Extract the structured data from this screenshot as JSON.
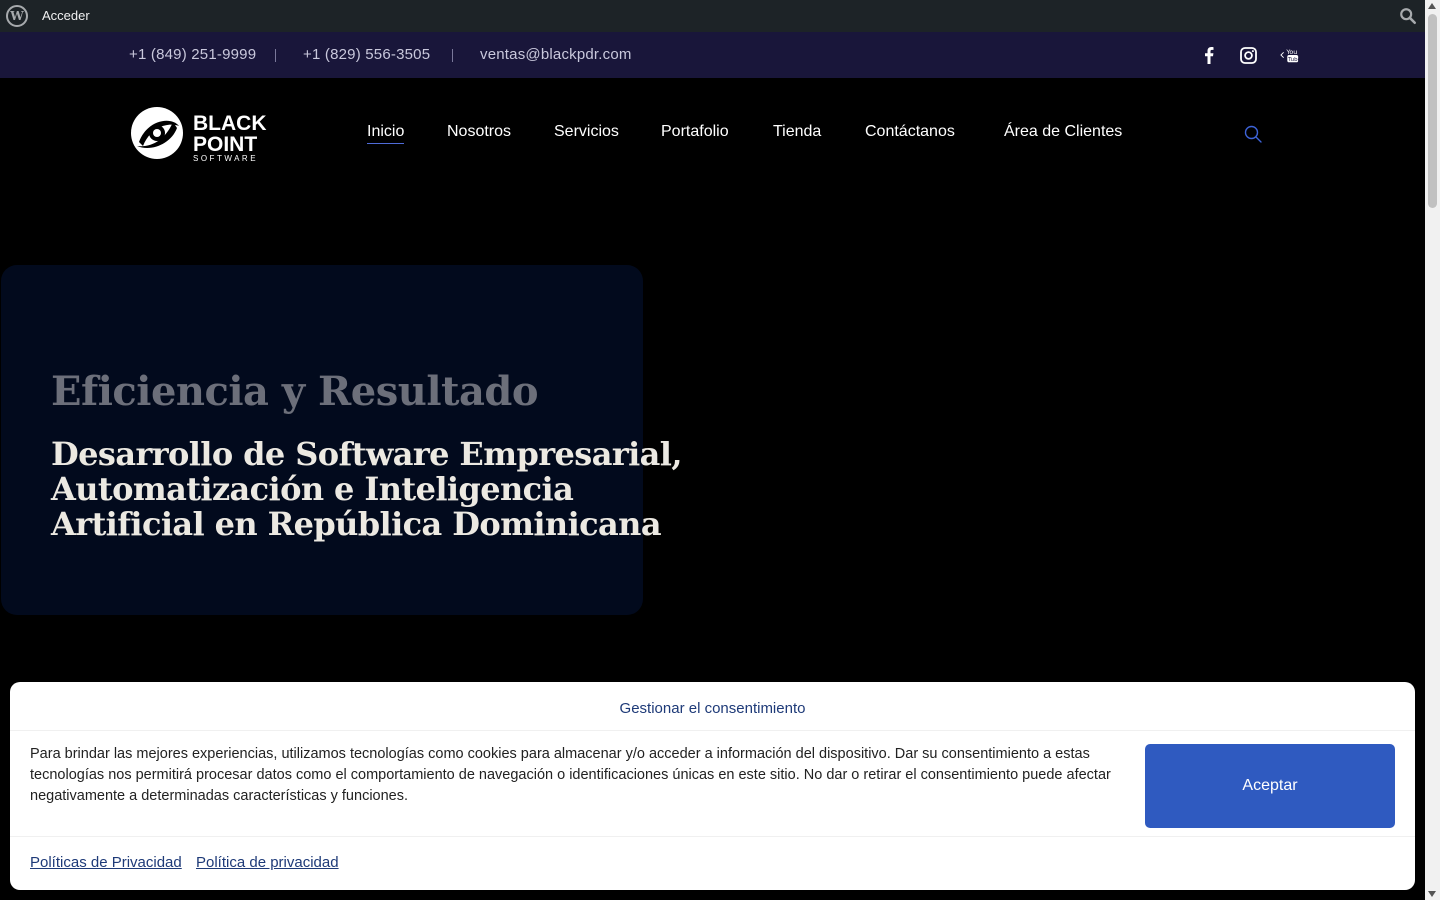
{
  "admin_bar": {
    "login_label": "Acceder",
    "wp_icon": "wordpress-icon",
    "search_icon": "search-icon"
  },
  "topbar": {
    "phone1": "+1 (849) 251-9999",
    "phone2": "+1 (829) 556-3505",
    "email": "ventas@blackpdr.com",
    "social": [
      "facebook-icon",
      "instagram-icon",
      "youtube-icon"
    ]
  },
  "brand": {
    "line1": "BLACK",
    "line2": "POINT",
    "line3": "SOFTWARE"
  },
  "nav": {
    "items": [
      "Inicio",
      "Nosotros",
      "Servicios",
      "Portafolio",
      "Tienda",
      "Contáctanos",
      "Área de Clientes"
    ],
    "active_index": 0
  },
  "hero": {
    "eyebrow": "Eficiencia y Resultado",
    "title": "Desarrollo de Software Empresarial, Automatización e Inteligencia Artificial en República Dominicana"
  },
  "consent": {
    "title": "Gestionar el consentimiento",
    "body": "Para brindar las mejores experiencias, utilizamos tecnologías como cookies para almacenar y/o acceder a información del dispositivo. Dar su consentimiento a estas tecnologías nos permitirá procesar datos como el comportamiento de navegación o identificaciones únicas en este sitio. No dar o retirar el consentimiento puede afectar negativamente a determinadas características y funciones.",
    "accept_label": "Aceptar",
    "links": [
      "Políticas de Privacidad",
      "Política de privacidad"
    ]
  },
  "colors": {
    "topbar_bg": "#19163a",
    "hero_card_bg": "#020a1d",
    "accent_blue": "#2f5ac0",
    "link_blue": "#1e3a78"
  }
}
